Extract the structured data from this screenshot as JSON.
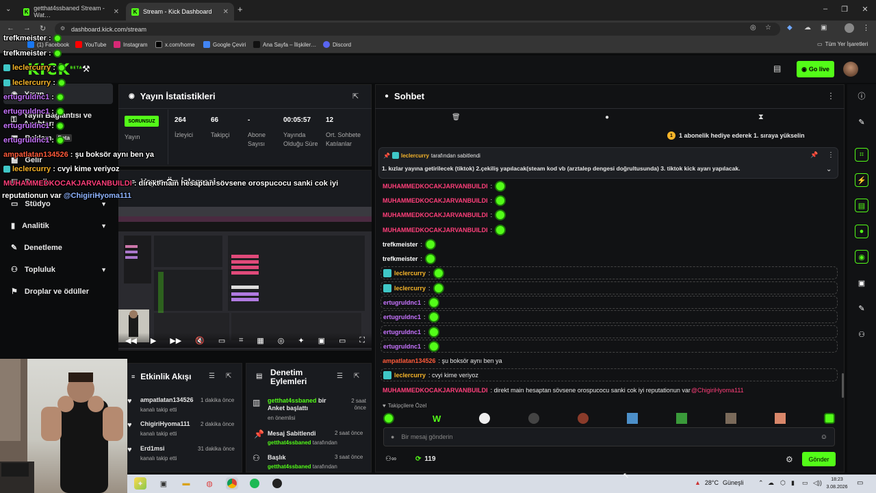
{
  "browser": {
    "tabs": [
      {
        "label": "getthat4ssbaned Stream - Wat…",
        "active": false
      },
      {
        "label": "Stream - Kick Dashboard",
        "active": true
      }
    ],
    "url": "dashboard.kick.com/stream",
    "bookmarks": [
      "(1) Facebook",
      "YouTube",
      "Instagram",
      "x.com/home",
      "Google Çeviri",
      "Ana Sayfa – İlişkiler…",
      "Discord"
    ],
    "all_bookmarks": "Tüm Yer İşaretleri"
  },
  "kick": {
    "logo": "KICK",
    "logo_badge": "BETA",
    "go_live": "Go live",
    "accent": "#53fc18"
  },
  "sidebar": {
    "items": [
      {
        "label": "Yayın"
      },
      {
        "label": "Yayın Bağlantısı ve Anahtarı"
      },
      {
        "label": "Reklam",
        "badge": "Beta"
      },
      {
        "label": "Gelir"
      },
      {
        "label": "Paneller"
      },
      {
        "label": "Stüdyo"
      },
      {
        "label": "Analitik"
      },
      {
        "label": "Denetleme"
      },
      {
        "label": "Topluluk"
      },
      {
        "label": "Droplar ve ödüller"
      }
    ]
  },
  "stats": {
    "title": "Yayın İstatistikleri",
    "status_badge": "SORUNSUZ",
    "status_label": "Yayın",
    "items": [
      {
        "value": "264",
        "label": "İzleyici"
      },
      {
        "value": "66",
        "label": "Takipçi"
      },
      {
        "value": "-",
        "label": "Abone Sayısı"
      },
      {
        "value": "00:05:57",
        "label": "Yayında Olduğu Süre"
      },
      {
        "value": "12",
        "label": "Ort. Sohbete Katılanlar"
      }
    ]
  },
  "preview": {
    "title": "Yayın Ön İzlemesi"
  },
  "chat": {
    "title": "Sohbet",
    "gift_banner": "1 abonelik hediye ederek 1. sıraya yükselin",
    "pinned_by_user": "leclercurry",
    "pinned_by_suffix": "tarafından sabitlendi",
    "pinned_text": "1. kızlar yayına getirilecek (tiktok) 2.çekiliş yapılacak(steam kod vb (arztalep dengesi doğrultusunda) 3. tiktok kick ayarı yapılacak.",
    "messages": [
      {
        "user": "MUHAMMEDKOCAKJARVANBUILDI",
        "color": "#ff3f7a",
        "text": ":",
        "emote": true,
        "badge": false,
        "boxed": false
      },
      {
        "user": "MUHAMMEDKOCAKJARVANBUILDI",
        "color": "#ff3f7a",
        "text": ":",
        "emote": true,
        "badge": false,
        "boxed": false
      },
      {
        "user": "MUHAMMEDKOCAKJARVANBUILDI",
        "color": "#ff3f7a",
        "text": ":",
        "emote": true,
        "badge": false,
        "boxed": false
      },
      {
        "user": "MUHAMMEDKOCAKJARVANBUILDI",
        "color": "#ff3f7a",
        "text": ":",
        "emote": true,
        "badge": false,
        "boxed": false
      },
      {
        "user": "trefkmeister",
        "color": "#ffffff",
        "text": ":",
        "emote": true,
        "badge": false,
        "boxed": false
      },
      {
        "user": "trefkmeister",
        "color": "#ffffff",
        "text": ":",
        "emote": true,
        "badge": false,
        "boxed": false
      },
      {
        "user": "leclercurry",
        "color": "#f7b52a",
        "text": ":",
        "emote": true,
        "badge": true,
        "boxed": true
      },
      {
        "user": "leclercurry",
        "color": "#f7b52a",
        "text": ":",
        "emote": true,
        "badge": true,
        "boxed": true
      },
      {
        "user": "ertugruldnc1",
        "color": "#c774ff",
        "text": ":",
        "emote": true,
        "badge": false,
        "boxed": true
      },
      {
        "user": "ertugruldnc1",
        "color": "#c774ff",
        "text": ":",
        "emote": true,
        "badge": false,
        "boxed": true
      },
      {
        "user": "ertugruldnc1",
        "color": "#c774ff",
        "text": ":",
        "emote": true,
        "badge": false,
        "boxed": true
      },
      {
        "user": "ertugruldnc1",
        "color": "#c774ff",
        "text": ":",
        "emote": true,
        "badge": false,
        "boxed": true
      },
      {
        "user": "ampatlatan134526",
        "color": "#ff5a3a",
        "text": ": şu boksör aynı ben ya",
        "emote": false,
        "badge": false,
        "boxed": false
      },
      {
        "user": "leclercurry",
        "color": "#f7b52a",
        "text": ": cvyi kime veriyoz",
        "emote": false,
        "badge": true,
        "boxed": true
      },
      {
        "user": "MUHAMMEDKOCAKJARVANBUILDI",
        "color": "#ff3f7a",
        "text": ": direkt main hesaptan sövsene orospucocu sanki cok iyi reputationun var ",
        "mention": "@ChigiriHyoma111",
        "emote": false,
        "badge": false,
        "boxed": false
      }
    ],
    "follower_only_label": "Takipçilere Özel",
    "emotes_row": [
      "kick-emote",
      "w-emote",
      "face-emote",
      "dark-emote",
      "red-emote",
      "blue-emote",
      "green-emote",
      "brown-emote",
      "hand-emote",
      "slime-emote"
    ],
    "input_placeholder": "Bir mesaj gönderin",
    "kick_points": "119",
    "send_label": "Gönder"
  },
  "activity": {
    "title": "Etkinlik Akışı",
    "items": [
      {
        "user": "ampatlatan134526",
        "time": "1 dakika önce",
        "action": "kanalı takip etti"
      },
      {
        "user": "ChigiriHyoma111",
        "time": "2 dakika önce",
        "action": "kanalı takip etti"
      },
      {
        "user": "Erd1msi",
        "time": "31 dakika önce",
        "action": "kanalı takip etti"
      }
    ]
  },
  "moderation": {
    "title": "Denetim Eylemleri",
    "items": [
      {
        "head_user": "getthat4ssbaned",
        "head_rest": " bir Anket başlattı",
        "time": "2 saat önce",
        "sub_user": "",
        "sub_rest": "en önemlisi"
      },
      {
        "head_user": "",
        "head_rest": "Mesaj Sabitlendi",
        "time": "2 saat önce",
        "sub_user": "getthat4ssbaned",
        "sub_rest": " tarafından"
      },
      {
        "head_user": "",
        "head_rest": "Başlık",
        "time": "3 saat önce",
        "sub_user": "getthat4ssbaned",
        "sub_rest": " tarafından"
      }
    ]
  },
  "overlay_chat": [
    {
      "user": "trefkmeister",
      "color": "#ffffff",
      "text": " :",
      "emote": true,
      "badge": false
    },
    {
      "user": "trefkmeister",
      "color": "#ffffff",
      "text": " :",
      "emote": true,
      "badge": false
    },
    {
      "user": "leclercurry",
      "color": "#f7b52a",
      "text": " :",
      "emote": true,
      "badge": true
    },
    {
      "user": "leclercurry",
      "color": "#f7b52a",
      "text": " :",
      "emote": true,
      "badge": true
    },
    {
      "user": "ertugruldnc1",
      "color": "#c774ff",
      "text": " :",
      "emote": true,
      "badge": false
    },
    {
      "user": "ertugruldnc1",
      "color": "#c774ff",
      "text": " :",
      "emote": true,
      "badge": false
    },
    {
      "user": "ertugruldnc1",
      "color": "#c774ff",
      "text": " :",
      "emote": true,
      "badge": false
    },
    {
      "user": "ertugruldnc1",
      "color": "#c774ff",
      "text": " :",
      "emote": true,
      "badge": false
    },
    {
      "user": "ampatlatan134526",
      "color": "#ff5a3a",
      "text": " : şu boksör aynı ben ya",
      "emote": false,
      "badge": false
    },
    {
      "user": "leclercurry",
      "color": "#f7b52a",
      "text": " : cvyi kime veriyoz",
      "emote": false,
      "badge": true
    },
    {
      "user": "MUHAMMEDKOCAKJARVANBUILDI",
      "color": "#ff3f7a",
      "text": " : direkt main hesaptan sövsene orospucocu sanki cok iyi",
      "emote": false,
      "badge": false
    }
  ],
  "overlay_tail": {
    "text": "reputationun var ",
    "mention": "@ChigiriHyoma111"
  },
  "taskbar": {
    "weather": "28°C",
    "weather_label": "Güneşli",
    "time": "18:23",
    "date": "3.08.2026"
  }
}
